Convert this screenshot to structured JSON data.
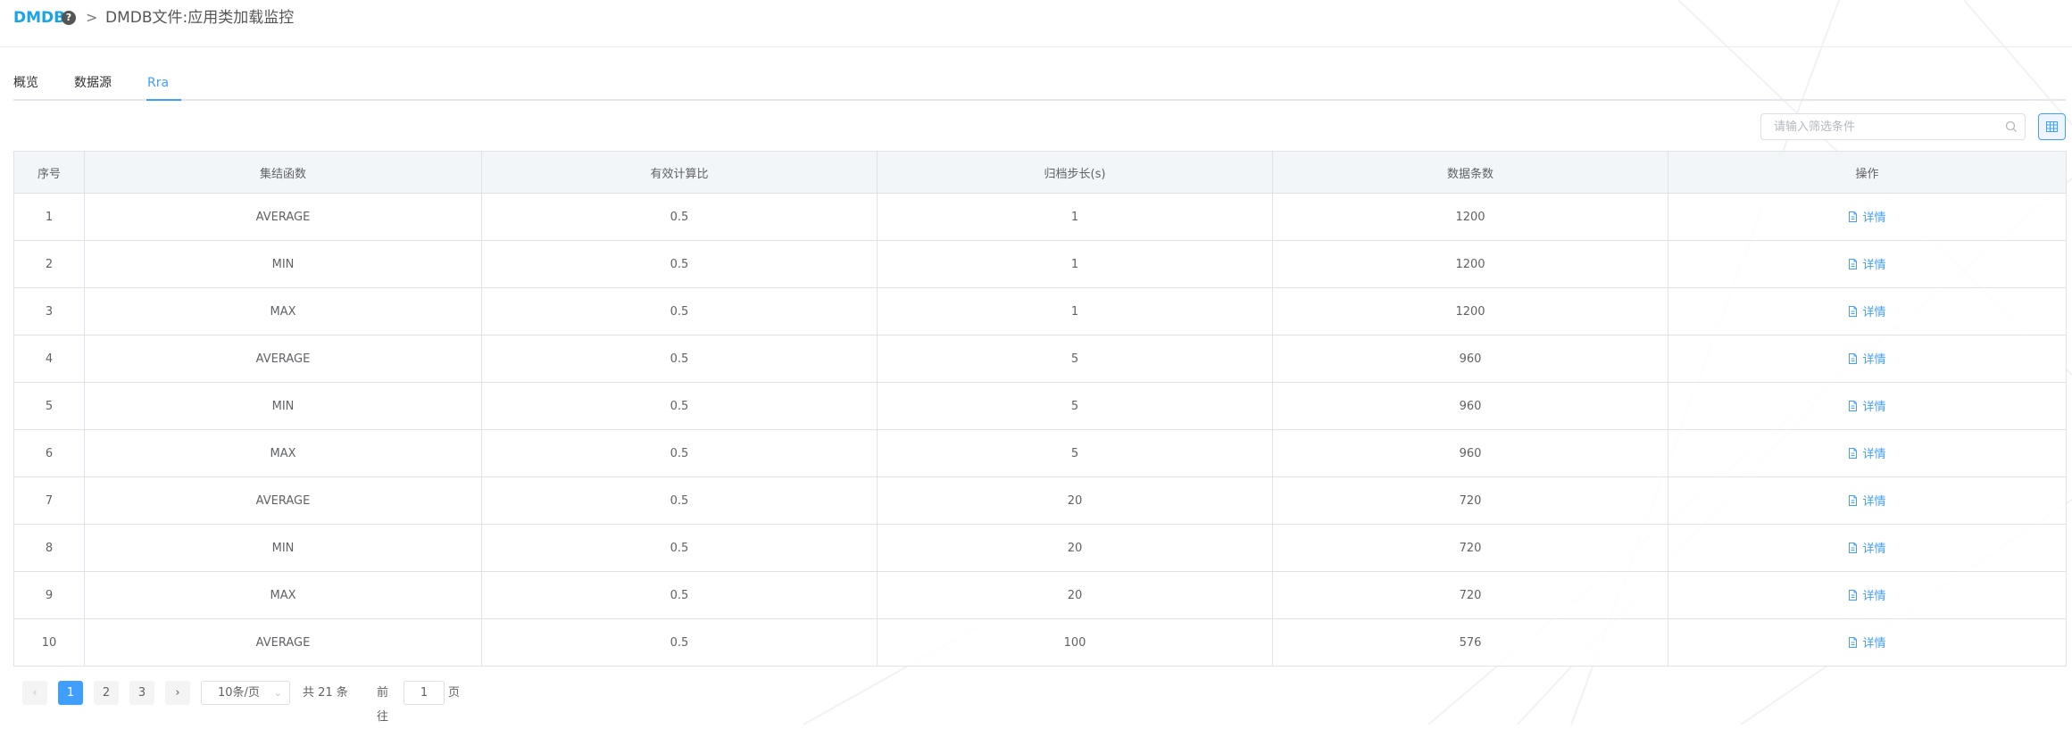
{
  "header": {
    "brand": "DMDB",
    "help_icon": "question-circle-icon",
    "breadcrumb_separator": ">",
    "current_page": "DMDB文件:应用类加载监控"
  },
  "tabs": [
    {
      "label": "概览",
      "active": false
    },
    {
      "label": "数据源",
      "active": false
    },
    {
      "label": "Rra",
      "active": true
    }
  ],
  "search": {
    "placeholder": "请输入筛选条件",
    "value": ""
  },
  "toolbar": {
    "column_settings_icon": "grid-columns-icon"
  },
  "table": {
    "columns": [
      "序号",
      "集结函数",
      "有效计算比",
      "归档步长(s)",
      "数据条数",
      "操作"
    ],
    "rows": [
      [
        "1",
        "AVERAGE",
        "0.5",
        "1",
        "1200",
        "详情"
      ],
      [
        "2",
        "MIN",
        "0.5",
        "1",
        "1200",
        "详情"
      ],
      [
        "3",
        "MAX",
        "0.5",
        "1",
        "1200",
        "详情"
      ],
      [
        "4",
        "AVERAGE",
        "0.5",
        "5",
        "960",
        "详情"
      ],
      [
        "5",
        "MIN",
        "0.5",
        "5",
        "960",
        "详情"
      ],
      [
        "6",
        "MAX",
        "0.5",
        "5",
        "960",
        "详情"
      ],
      [
        "7",
        "AVERAGE",
        "0.5",
        "20",
        "720",
        "详情"
      ],
      [
        "8",
        "MIN",
        "0.5",
        "20",
        "720",
        "详情"
      ],
      [
        "9",
        "MAX",
        "0.5",
        "20",
        "720",
        "详情"
      ],
      [
        "10",
        "AVERAGE",
        "0.5",
        "100",
        "576",
        "详情"
      ]
    ],
    "action_icon": "document-icon"
  },
  "pagination": {
    "pages": [
      "1",
      "2",
      "3"
    ],
    "current": "1",
    "page_size": "10条/页",
    "total": "共 21 条",
    "goto_label": "前往",
    "goto_value": "1",
    "page_suffix": "页"
  },
  "colors": {
    "brand": "#1aa3e8",
    "accent": "#409eff",
    "header_bg": "#f3f6f9",
    "border": "#dfe3e8"
  }
}
